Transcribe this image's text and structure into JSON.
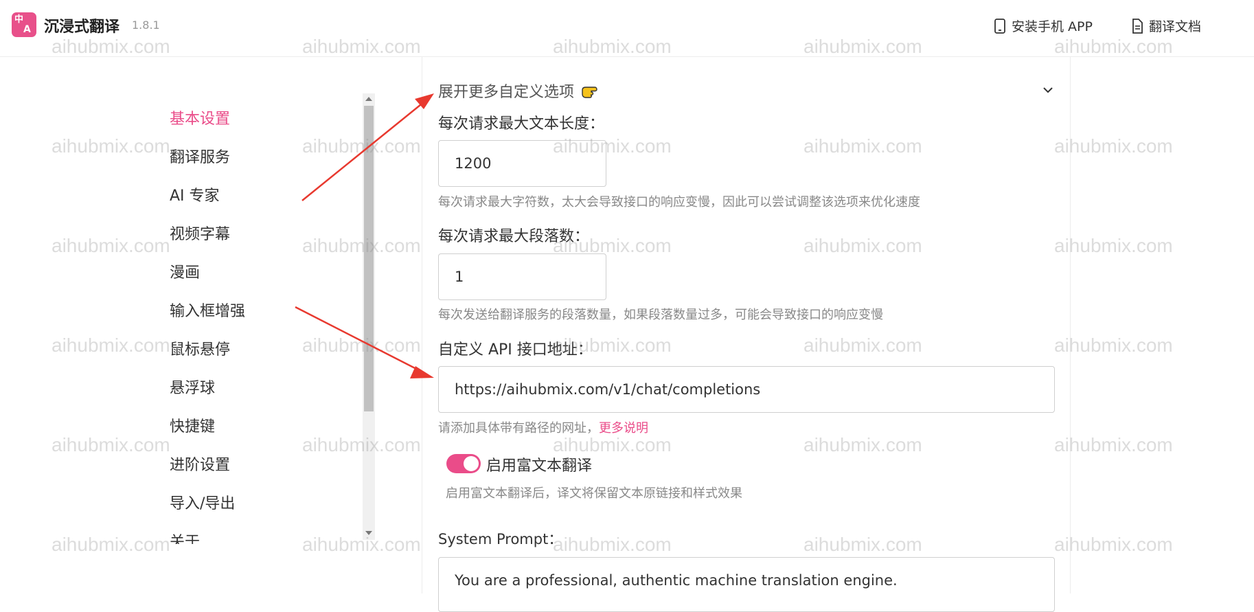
{
  "header": {
    "app_name": "沉浸式翻译",
    "version": "1.8.1",
    "logo_text_top": "中",
    "logo_text_bottom": "A",
    "install_app_label": "安装手机 APP",
    "translate_docs_label": "翻译文档"
  },
  "sidebar": {
    "items": [
      {
        "label": "基本设置",
        "active": true
      },
      {
        "label": "翻译服务"
      },
      {
        "label": "AI 专家"
      },
      {
        "label": "视频字幕"
      },
      {
        "label": "漫画"
      },
      {
        "label": "输入框增强"
      },
      {
        "label": "鼠标悬停"
      },
      {
        "label": "悬浮球"
      },
      {
        "label": "快捷键"
      },
      {
        "label": "进阶设置"
      },
      {
        "label": "导入/导出"
      },
      {
        "label": "关于"
      }
    ]
  },
  "main": {
    "expand_label": "展开更多自定义选项",
    "max_text_length": {
      "label": "每次请求最大文本长度：",
      "value": "1200",
      "help": "每次请求最大字符数，太大会导致接口的响应变慢，因此可以尝试调整该选项来优化速度"
    },
    "max_paragraphs": {
      "label": "每次请求最大段落数：",
      "value": "1",
      "help": "每次发送给翻译服务的段落数量，如果段落数量过多，可能会导致接口的响应变慢"
    },
    "api_url": {
      "label": "自定义 API 接口地址：",
      "value": "https://aihubmix.com/v1/chat/completions",
      "help": "请添加具体带有路径的网址，",
      "help_link": "更多说明"
    },
    "rich_text": {
      "label": "启用富文本翻译",
      "enabled": true,
      "help": "启用富文本翻译后，译文将保留文本原链接和样式效果"
    },
    "system_prompt": {
      "label": "System Prompt：",
      "value": "You are a professional, authentic machine translation engine."
    }
  },
  "watermark": "aihubmix.com",
  "colors": {
    "accent": "#ea4c89",
    "arrow": "#e8392f"
  }
}
